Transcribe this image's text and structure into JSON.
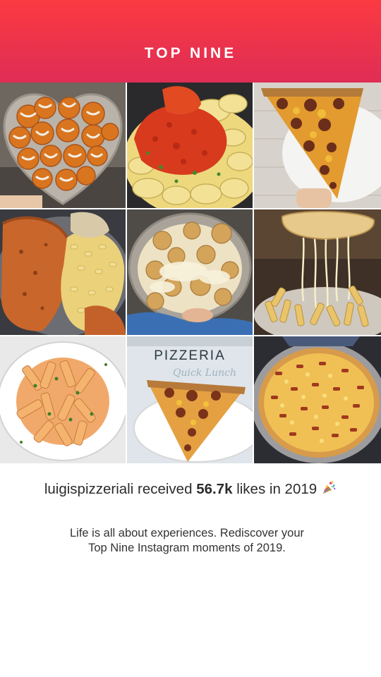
{
  "header": {
    "title": "TOP NINE",
    "gradient": [
      "#fb3a42",
      "#df2d55"
    ]
  },
  "grid": {
    "items": [
      {
        "name": "garlic-knots-heart-tray"
      },
      {
        "name": "tortellini-bolognese"
      },
      {
        "name": "bbq-pizza-slice"
      },
      {
        "name": "calzone-mac-and-cheese"
      },
      {
        "name": "garlic-knots-cheese-tray"
      },
      {
        "name": "cheesy-penne-pull"
      },
      {
        "name": "penne-vodka-plate"
      },
      {
        "name": "pizzeria-sign-pizza-slice",
        "sign_text": "PIZZERIA"
      },
      {
        "name": "bacon-mac-pizza"
      }
    ]
  },
  "summary": {
    "username": "luigispizzeriali",
    "received_text": " received ",
    "likes": "56.7k",
    "likes_suffix": " likes in 2019",
    "icon": "party-popper-icon"
  },
  "tagline": {
    "line1": "Life is all about experiences. Rediscover your",
    "line2": "Top Nine Instagram moments of 2019."
  }
}
